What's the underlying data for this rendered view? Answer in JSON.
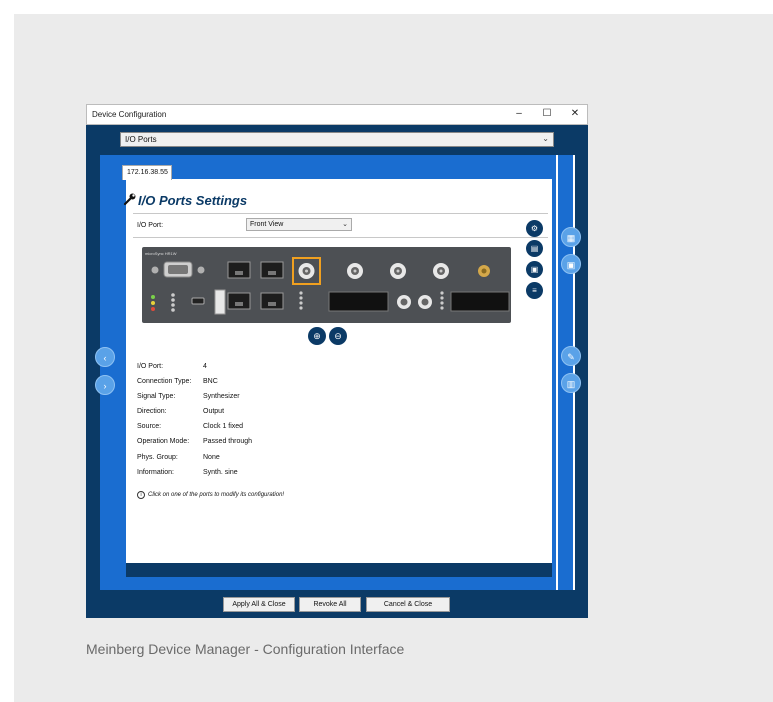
{
  "window": {
    "title": "Device Configuration",
    "controls": [
      "–",
      "☐",
      "✕"
    ]
  },
  "top_select": {
    "value": "I/O Ports"
  },
  "ip_tab": "172.16.38.55",
  "settings": {
    "heading": "I/O Ports Settings",
    "port_label": "I/O Port:",
    "view_select": "Front View",
    "device_label": "microSync HR1W"
  },
  "details": [
    {
      "label": "I/O Port:",
      "value": "4"
    },
    {
      "label": "Connection Type:",
      "value": "BNC"
    },
    {
      "label": "Signal Type:",
      "value": "Synthesizer"
    },
    {
      "label": "Direction:",
      "value": "Output"
    },
    {
      "label": "Source:",
      "value": "Clock 1 fixed"
    },
    {
      "label": "Operation Mode:",
      "value": "Passed through"
    },
    {
      "label": "Phys. Group:",
      "value": "None"
    },
    {
      "label": "Information:",
      "value": "Synth. sine"
    }
  ],
  "hint": "Click on one of the ports to modify its configuration!",
  "footer": {
    "apply": "Apply All & Close",
    "revoke": "Revoke All",
    "cancel": "Cancel & Close"
  },
  "caption": "Meinberg Device Manager - Configuration Interface",
  "colors": {
    "navy": "#0b3a66",
    "blue": "#1a6dd0",
    "highlight": "#f0a020"
  }
}
